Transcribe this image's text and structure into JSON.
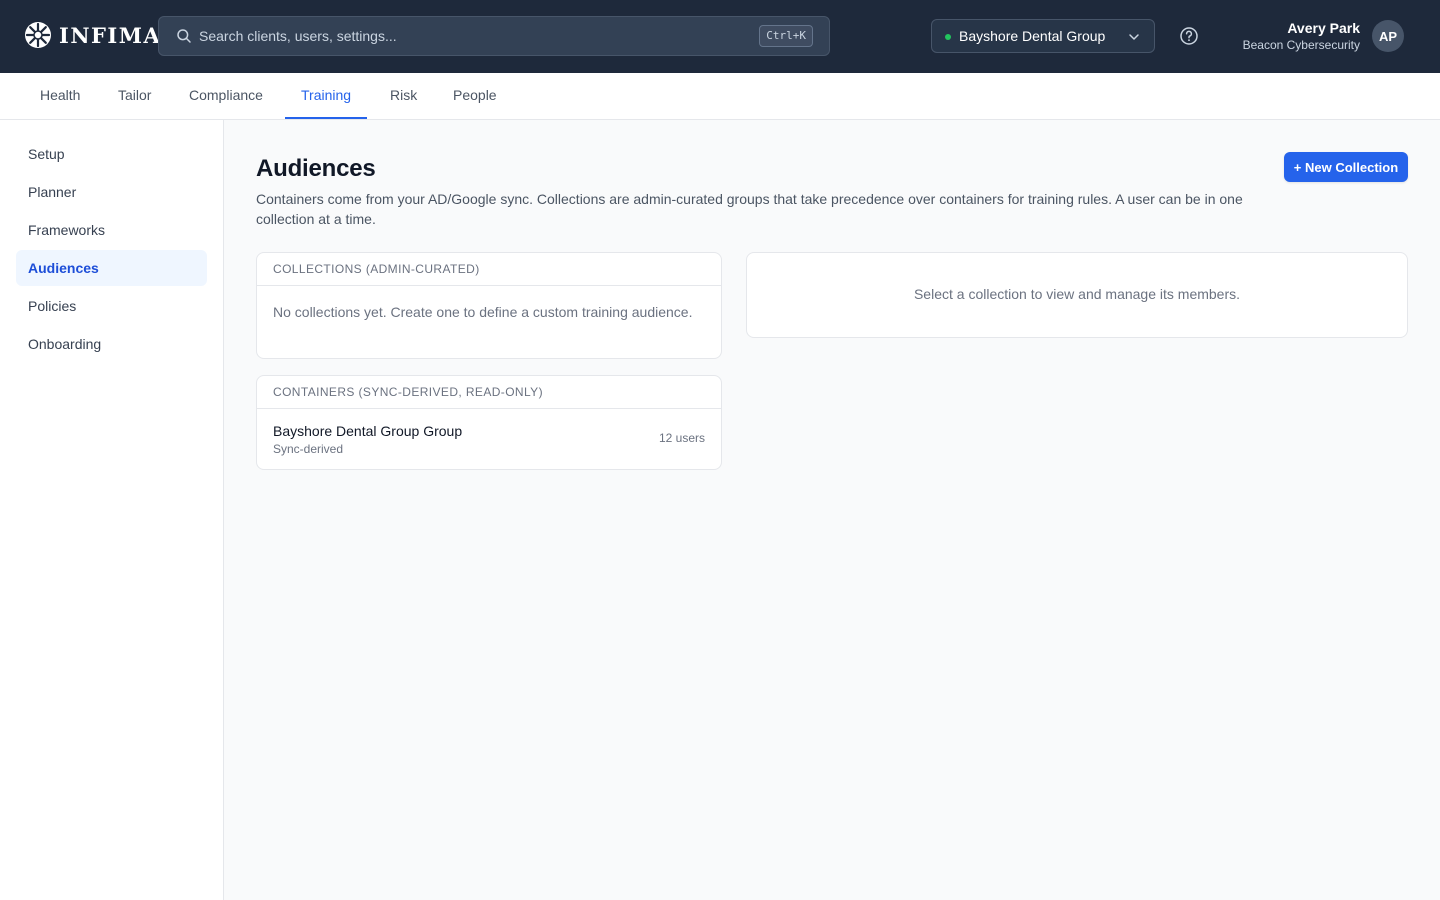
{
  "brand": {
    "name": "INFIMA"
  },
  "search": {
    "placeholder": "Search clients, users, settings...",
    "shortcut": "Ctrl+K"
  },
  "client_selector": {
    "selected": "Bayshore Dental Group",
    "status_color": "#22c55e"
  },
  "user": {
    "name": "Avery Park",
    "org": "Beacon Cybersecurity",
    "initials": "AP"
  },
  "tabs": [
    {
      "label": "Health"
    },
    {
      "label": "Tailor"
    },
    {
      "label": "Compliance"
    },
    {
      "label": "Training",
      "active": true
    },
    {
      "label": "Risk"
    },
    {
      "label": "People"
    }
  ],
  "sidebar": {
    "items": [
      {
        "label": "Setup"
      },
      {
        "label": "Planner"
      },
      {
        "label": "Frameworks"
      },
      {
        "label": "Audiences",
        "active": true
      },
      {
        "label": "Policies"
      },
      {
        "label": "Onboarding"
      }
    ]
  },
  "page": {
    "title": "Audiences",
    "description": "Containers come from your AD/Google sync. Collections are admin-curated groups that take precedence over containers for training rules. A user can be in one collection at a time.",
    "new_button": "+ New Collection"
  },
  "collections": {
    "header": "COLLECTIONS (ADMIN-CURATED)",
    "empty_text": "No collections yet. Create one to define a custom training audience."
  },
  "containers": {
    "header": "CONTAINERS (SYNC-DERIVED, READ-ONLY)",
    "rows": [
      {
        "name": "Bayshore Dental Group Group",
        "source": "Sync-derived",
        "count": "12 users"
      }
    ]
  },
  "detail_panel": {
    "empty_text": "Select a collection to view and manage its members."
  },
  "colors": {
    "accent": "#2563eb",
    "topbar": "#1e293b",
    "active_bg": "#eff6ff"
  },
  "icons": [
    "logo-icon",
    "search-icon",
    "chevron-down-icon",
    "help-icon"
  ]
}
